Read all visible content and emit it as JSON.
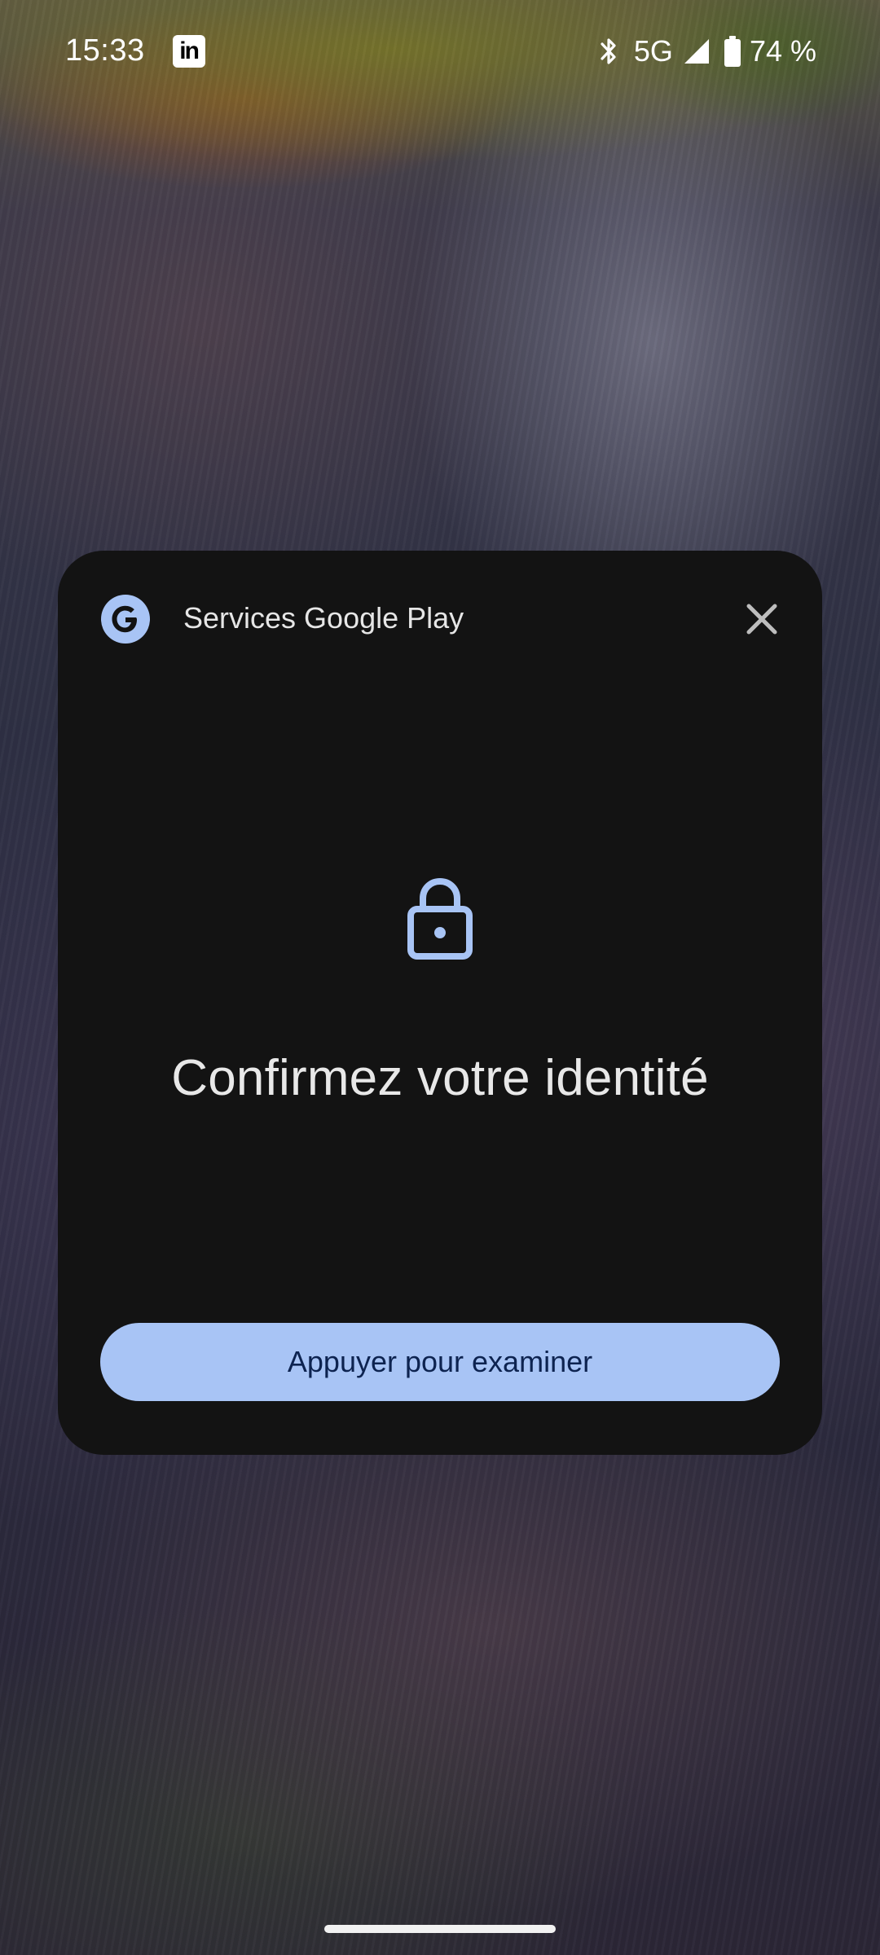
{
  "status_bar": {
    "time": "15:33",
    "notification_icons": [
      "linkedin-icon"
    ],
    "network": "5G",
    "battery": "74 %",
    "icons": [
      "bluetooth-icon",
      "signal-icon",
      "battery-icon"
    ]
  },
  "dialog": {
    "app_name": "Services Google Play",
    "app_icon": "google-g-icon",
    "close_icon": "close-icon",
    "lock_icon": "lock-icon",
    "title": "Confirmez votre identité",
    "primary_button_label": "Appuyer pour examiner"
  },
  "colors": {
    "dialog_background": "#131313",
    "accent": "#a8c4f5",
    "button_text": "#0d2350"
  }
}
